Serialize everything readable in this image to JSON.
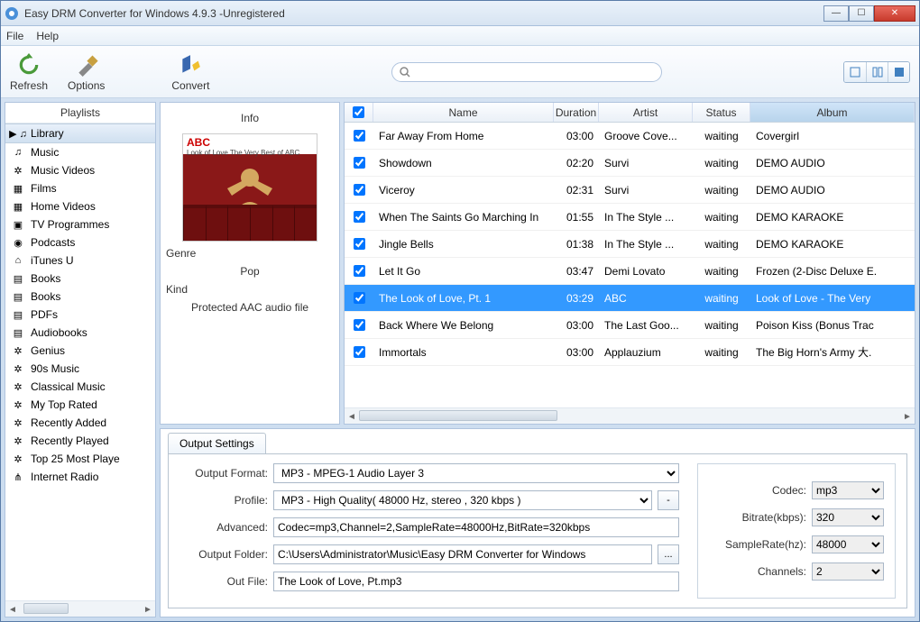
{
  "window": {
    "title": "Easy DRM Converter for Windows 4.9.3 -Unregistered"
  },
  "menu": {
    "file": "File",
    "help": "Help"
  },
  "toolbar": {
    "refresh": "Refresh",
    "options": "Options",
    "convert": "Convert"
  },
  "search": {
    "placeholder": ""
  },
  "sidebar": {
    "header": "Playlists",
    "items": [
      {
        "label": "Library",
        "selected": true
      },
      {
        "label": "Music"
      },
      {
        "label": "Music Videos"
      },
      {
        "label": "Films"
      },
      {
        "label": "Home Videos"
      },
      {
        "label": "TV Programmes"
      },
      {
        "label": "Podcasts"
      },
      {
        "label": "iTunes U"
      },
      {
        "label": "Books"
      },
      {
        "label": "Books"
      },
      {
        "label": "PDFs"
      },
      {
        "label": "Audiobooks"
      },
      {
        "label": "Genius"
      },
      {
        "label": "90s Music"
      },
      {
        "label": "Classical Music"
      },
      {
        "label": "My Top Rated"
      },
      {
        "label": "Recently Added"
      },
      {
        "label": "Recently Played"
      },
      {
        "label": "Top 25 Most Playe"
      },
      {
        "label": "Internet Radio"
      }
    ]
  },
  "info": {
    "header": "Info",
    "album_art_title": "ABC",
    "album_art_sub": "Look of Love\nThe Very Best of ABC",
    "genre_label": "Genre",
    "genre_value": "Pop",
    "kind_label": "Kind",
    "kind_value": "Protected AAC audio file"
  },
  "table": {
    "cols": {
      "name": "Name",
      "duration": "Duration",
      "artist": "Artist",
      "status": "Status",
      "album": "Album"
    },
    "rows": [
      {
        "name": "Far Away From Home",
        "dur": "03:00",
        "artist": "Groove Cove...",
        "status": "waiting",
        "album": "Covergirl"
      },
      {
        "name": "Showdown",
        "dur": "02:20",
        "artist": "Survi",
        "status": "waiting",
        "album": "DEMO AUDIO"
      },
      {
        "name": "Viceroy",
        "dur": "02:31",
        "artist": "Survi",
        "status": "waiting",
        "album": "DEMO AUDIO"
      },
      {
        "name": "When The Saints Go Marching In",
        "dur": "01:55",
        "artist": "In The Style ...",
        "status": "waiting",
        "album": "DEMO KARAOKE"
      },
      {
        "name": "Jingle Bells",
        "dur": "01:38",
        "artist": "In The Style ...",
        "status": "waiting",
        "album": "DEMO KARAOKE"
      },
      {
        "name": "Let It Go",
        "dur": "03:47",
        "artist": "Demi Lovato",
        "status": "waiting",
        "album": "Frozen (2-Disc Deluxe E."
      },
      {
        "name": "The Look of Love, Pt. 1",
        "dur": "03:29",
        "artist": "ABC",
        "status": "waiting",
        "album": "Look of Love - The Very",
        "selected": true
      },
      {
        "name": "Back Where We Belong",
        "dur": "03:00",
        "artist": "The Last Goo...",
        "status": "waiting",
        "album": "Poison Kiss (Bonus Trac"
      },
      {
        "name": "Immortals",
        "dur": "03:00",
        "artist": "Applauzium",
        "status": "waiting",
        "album": "The Big Horn's Army 大."
      }
    ]
  },
  "output": {
    "tab": "Output Settings",
    "format_label": "Output Format:",
    "format_value": "MP3 - MPEG-1 Audio Layer 3",
    "profile_label": "Profile:",
    "profile_value": "MP3 - High Quality( 48000 Hz, stereo , 320 kbps  )",
    "advanced_label": "Advanced:",
    "advanced_value": "Codec=mp3,Channel=2,SampleRate=48000Hz,BitRate=320kbps",
    "folder_label": "Output Folder:",
    "folder_value": "C:\\Users\\Administrator\\Music\\Easy DRM Converter for Windows",
    "outfile_label": "Out File:",
    "outfile_value": "The Look of Love, Pt.mp3",
    "codec_label": "Codec:",
    "codec_value": "mp3",
    "bitrate_label": "Bitrate(kbps):",
    "bitrate_value": "320",
    "samplerate_label": "SampleRate(hz):",
    "samplerate_value": "48000",
    "channels_label": "Channels:",
    "channels_value": "2",
    "browse_btn": "...",
    "profile_btn": "-"
  }
}
